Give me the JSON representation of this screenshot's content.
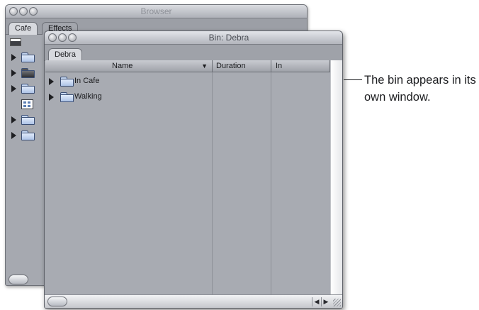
{
  "browser": {
    "title": "Browser",
    "tabs": [
      {
        "label": "Cafe"
      },
      {
        "label": "Effects"
      }
    ]
  },
  "bin": {
    "title": "Bin: Debra",
    "tab_label": "Debra",
    "columns": {
      "name": "Name",
      "duration": "Duration",
      "in": "In"
    },
    "items": [
      {
        "label": "In Cafe"
      },
      {
        "label": "Walking"
      }
    ]
  },
  "callout": "The bin appears in its own window.",
  "icons": {
    "folder": "folder-icon",
    "disclosure": "disclosure-triangle-icon",
    "sort": "sort-descending-icon",
    "clapper": "clapperboard-icon",
    "clip": "sequence-icon"
  },
  "colors": {
    "window_bg": "#a8abb2",
    "folder_blue": "#adc3e6"
  }
}
